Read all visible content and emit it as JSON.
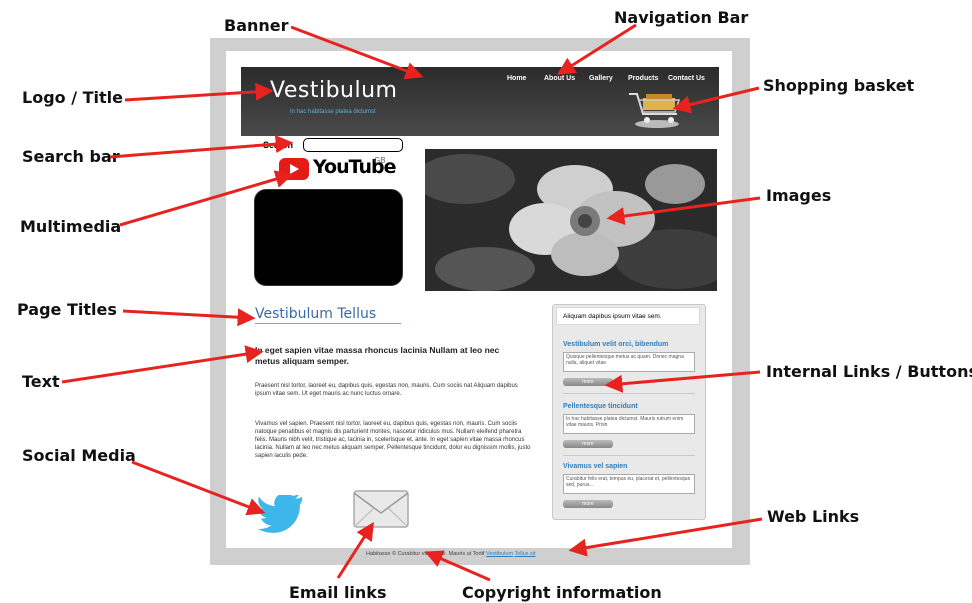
{
  "labels": {
    "banner": "Banner",
    "navigation_bar": "Navigation Bar",
    "logo_title": "Logo / Title",
    "shopping_basket": "Shopping basket",
    "search_bar": "Search bar",
    "multimedia": "Multimedia",
    "images": "Images",
    "page_titles": "Page Titles",
    "text": "Text",
    "internal_links": "Internal Links / Buttons",
    "social_media": "Social Media",
    "web_links": "Web Links",
    "email_links": "Email links",
    "copyright": "Copyright information"
  },
  "mockup": {
    "logo_title": "Vestibulum",
    "tagline": "In hac habitasse platea dictumst",
    "nav": [
      "Home",
      "About Us",
      "Gallery",
      "Products",
      "Contact Us"
    ],
    "search_label": "Search",
    "youtube_word": "YouTube",
    "youtube_region": "GB",
    "page_title": "Vestibulum Tellus",
    "lead_text": "In eget sapien vitae massa rhoncus lacinia Nullam at leo nec metus aliquam semper.",
    "body_1": "Praesent nisl tortor, laoreet eu, dapibus quis, egestas non, mauris. Cum sociis nat Aliquam dapibus ipsum vitae sem. Ut eget mauris ac nunc luctus ornare.",
    "body_2": "Vivamus vel sapien. Praesent nisl tortor, laoreet eu, dapibus quis, egestas non, mauris. Cum sociis natoque penatibus et magnis dis parturient montes, nascetur ridiculus mus. Nullam eleifend pharetra felis. Mauris nibh velit, tristique ac, lacinia in, scelerisque et, ante. In eget sapien vitae massa rhoncus lacinia. Nullam at leo nec metus aliquam semper. Pellentesque tincidunt, dolor eu dignissim mollis, justo sapien iaculis pede.",
    "sidebar_head": "Aliquam dapibus ipsum vitae sem.",
    "sidebar": [
      {
        "heading": "Vestibulum velit orci, bibendum",
        "text": "Quisque pellentesque metus ac quam. Donec magna nulla, aliquet vitae",
        "button": "more"
      },
      {
        "heading": "Pellentesque tincidunt",
        "text": "In hac habitasse platea dictumst. Mauris rutrum enim vitae mauris. Proin",
        "button": "more"
      },
      {
        "heading": "Vivamus vel sapien",
        "text": "Curabitur felis erat, tempus eu, placerat et, pellentesque sed, purus...",
        "button": "more"
      }
    ],
    "footer_text": "Habitasse © Curabitur vitae ante. Mauris ut Tortif",
    "footer_links": [
      "Vestibulum",
      "Tellus sit"
    ]
  },
  "colors": {
    "arrow": "#e8231f",
    "banner": "#3a3a3a",
    "link_blue": "#2e7fc0",
    "twitter": "#3fb6ea"
  },
  "icons": [
    "shopping-basket-icon",
    "youtube-play-icon",
    "twitter-icon",
    "email-envelope-icon"
  ]
}
